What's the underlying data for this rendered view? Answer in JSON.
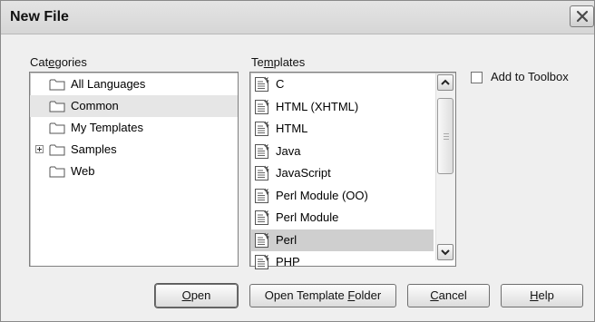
{
  "window": {
    "title": "New File"
  },
  "categories": {
    "label": "Categories",
    "items": [
      {
        "label": "All Languages",
        "expandable": false,
        "selected": false
      },
      {
        "label": "Common",
        "expandable": false,
        "selected": true
      },
      {
        "label": "My Templates",
        "expandable": false,
        "selected": false
      },
      {
        "label": "Samples",
        "expandable": true,
        "selected": false
      },
      {
        "label": "Web",
        "expandable": false,
        "selected": false
      }
    ]
  },
  "templates": {
    "label": "Templates",
    "items": [
      {
        "label": "C",
        "selected": false
      },
      {
        "label": "HTML (XHTML)",
        "selected": false
      },
      {
        "label": "HTML",
        "selected": false
      },
      {
        "label": "Java",
        "selected": false
      },
      {
        "label": "JavaScript",
        "selected": false
      },
      {
        "label": "Perl Module (OO)",
        "selected": false
      },
      {
        "label": "Perl Module",
        "selected": false
      },
      {
        "label": "Perl",
        "selected": true
      },
      {
        "label": "PHP",
        "selected": false
      }
    ]
  },
  "add_to_toolbox": {
    "label": "Add to Toolbox",
    "checked": false
  },
  "buttons": {
    "open": "Open",
    "open_template_folder": "Open Template Folder",
    "cancel": "Cancel",
    "help": "Help"
  },
  "icons": {
    "close": "close-icon",
    "folder": "folder-icon",
    "template": "document-template-icon",
    "scroll_up": "chevron-up-icon",
    "scroll_down": "chevron-down-icon"
  }
}
